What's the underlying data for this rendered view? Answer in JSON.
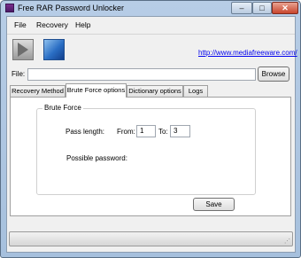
{
  "window": {
    "title": "Free RAR Password Unlocker"
  },
  "menu": {
    "items": [
      "File",
      "Recovery",
      "Help"
    ]
  },
  "toolbar": {
    "link_text": "http://www.mediafreeware.com/"
  },
  "file": {
    "label": "File:",
    "value": "",
    "browse_label": "Browse"
  },
  "tabs": [
    {
      "label": "Recovery Method"
    },
    {
      "label": "Brute Force options"
    },
    {
      "label": "Dictionary options"
    },
    {
      "label": "Logs"
    }
  ],
  "brute_force": {
    "group_title": "Brute Force",
    "pass_length_label": "Pass length:",
    "from_label": "From:",
    "from_value": "1",
    "to_label": "To:",
    "to_value": "3",
    "possible_password_label": "Possible password:",
    "possible_password_value": "",
    "save_label": "Save"
  },
  "colors": {
    "link": "#0000ee",
    "title_icon": "#5e2178"
  }
}
